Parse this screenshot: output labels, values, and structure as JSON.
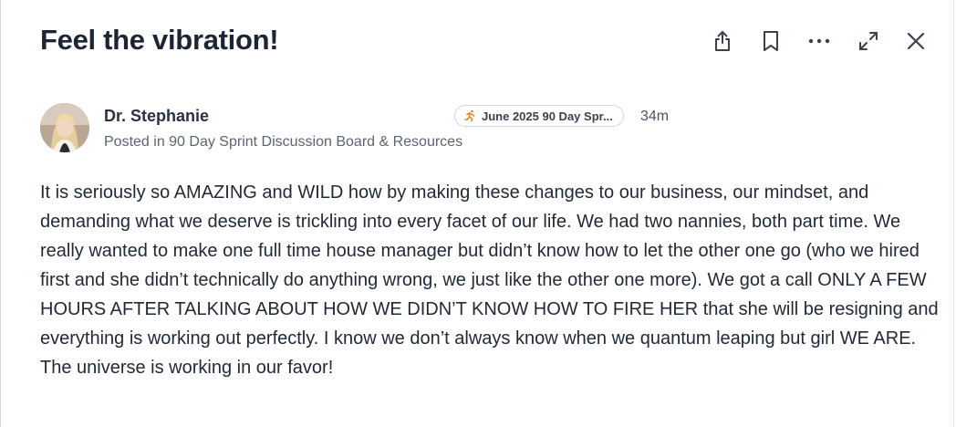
{
  "post": {
    "title": "Feel the vibration!",
    "author": {
      "name": "Dr. Stephanie",
      "posted_in": "Posted in 90 Day Sprint Discussion Board & Resources"
    },
    "space_badge": {
      "icon": "running-person-icon",
      "label": "June 2025 90 Day Spr..."
    },
    "timestamp": "34m",
    "body": "It is seriously so AMAZING and WILD how by making these changes to our business, our mindset, and demanding what we deserve is trickling into every facet of our life. We had two nannies, both part time. We really wanted to make one full time house manager but didn’t know how to let the other one go (who we hired first and she didn’t technically do anything wrong, we just like the other one more). We got a call ONLY A FEW HOURS AFTER TALKING ABOUT HOW WE DIDN’T KNOW HOW TO FIRE HER that she will be resigning and everything is working out perfectly. I know we don’t always know when we quantum leaping but girl WE ARE. The universe is working in our favor!"
  },
  "header_actions": [
    {
      "name": "share-icon"
    },
    {
      "name": "bookmark-icon"
    },
    {
      "name": "more-options-icon"
    },
    {
      "name": "expand-icon"
    },
    {
      "name": "close-icon"
    }
  ],
  "colors": {
    "text_primary": "#1d2434",
    "text_secondary": "#5d6470",
    "border": "#d6d8dc",
    "icon": "#3a4150"
  }
}
